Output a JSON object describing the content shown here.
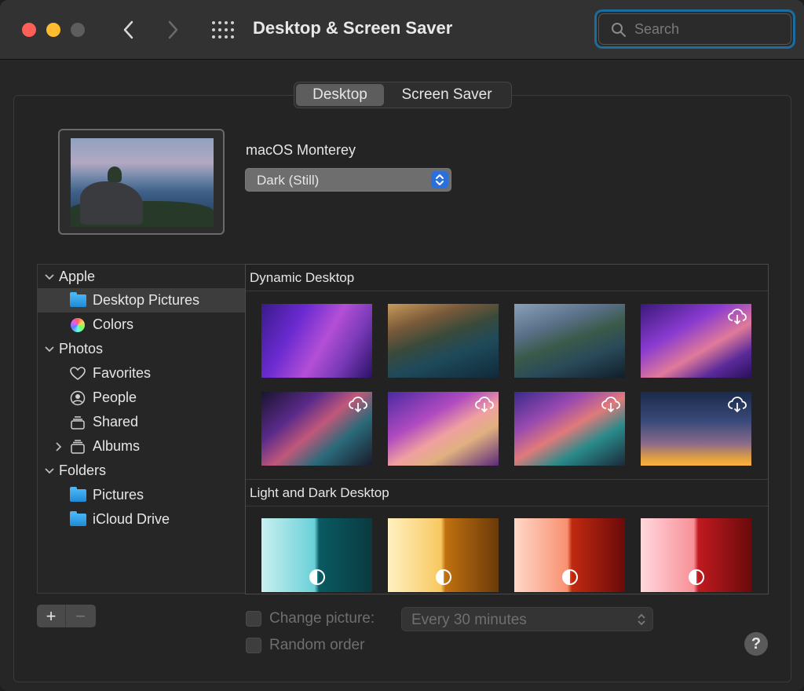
{
  "window": {
    "title": "Desktop & Screen Saver"
  },
  "search": {
    "placeholder": "Search"
  },
  "tabs": [
    {
      "label": "Desktop",
      "active": true
    },
    {
      "label": "Screen Saver",
      "active": false
    }
  ],
  "current": {
    "name": "macOS Monterey",
    "mode_label": "Dark (Still)"
  },
  "sidebar": {
    "groups": [
      {
        "label": "Apple",
        "expanded": true,
        "items": [
          {
            "label": "Desktop Pictures",
            "icon": "folder-icon",
            "selected": true
          },
          {
            "label": "Colors",
            "icon": "color-wheel-icon",
            "selected": false
          }
        ]
      },
      {
        "label": "Photos",
        "expanded": true,
        "items": [
          {
            "label": "Favorites",
            "icon": "heart-icon"
          },
          {
            "label": "People",
            "icon": "person-icon"
          },
          {
            "label": "Shared",
            "icon": "shared-album-icon"
          },
          {
            "label": "Albums",
            "icon": "album-stack-icon",
            "collapsed": true
          }
        ]
      },
      {
        "label": "Folders",
        "expanded": true,
        "items": [
          {
            "label": "Pictures",
            "icon": "folder-icon"
          },
          {
            "label": "iCloud Drive",
            "icon": "folder-icon"
          }
        ]
      }
    ]
  },
  "gallery": {
    "sections": [
      {
        "title": "Dynamic Desktop"
      },
      {
        "title": "Light and Dark Desktop"
      }
    ]
  },
  "options": {
    "change_picture_label": "Change picture:",
    "interval": "Every 30 minutes",
    "random_order_label": "Random order"
  },
  "buttons": {
    "add": "+",
    "remove": "−",
    "help": "?"
  },
  "colors": {
    "accent": "#2b6fdc",
    "search_focus": "#1a6d9e",
    "close": "#fe5f57",
    "minimize": "#febc2e"
  }
}
